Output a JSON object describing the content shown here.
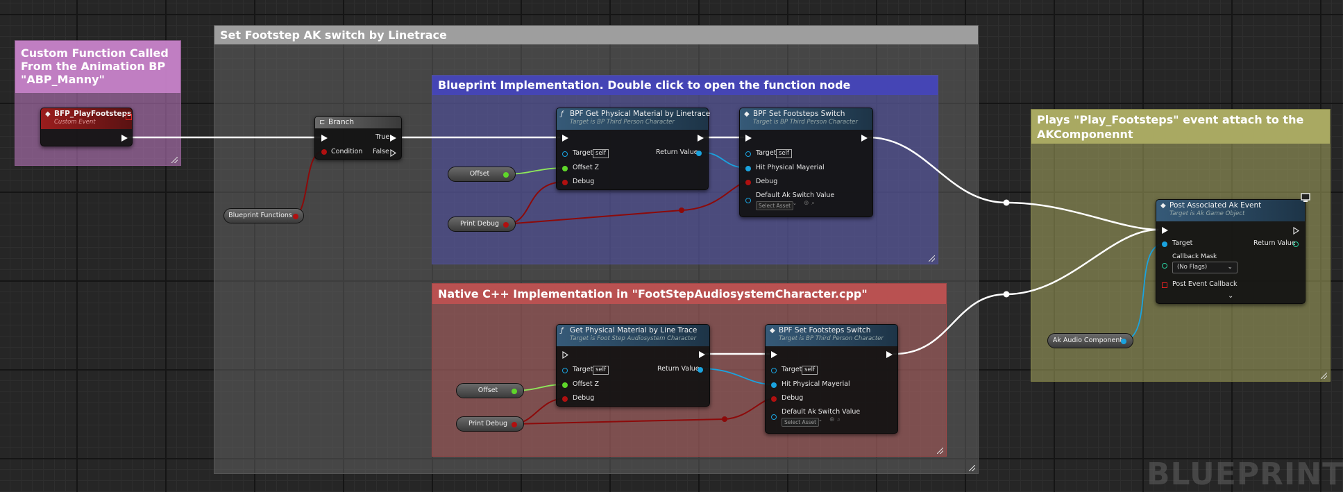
{
  "comments": {
    "custom_func": {
      "title": "Custom Function Called From the Animation BP \"ABP_Manny\""
    },
    "set_footstep": {
      "title": "Set Footstep AK switch by Linetrace"
    },
    "bp_impl": {
      "title": "Blueprint Implementation. Double click to open the function node"
    },
    "native_impl": {
      "title": "Native C++ Implementation in \"FootStepAudiosystemCharacter.cpp\""
    },
    "plays": {
      "title": "Plays \"Play_Footsteps\" event attach to the AKComponennt"
    }
  },
  "nodes": {
    "event": {
      "title": "BFP_PlayFootsteps",
      "subtitle": "Custom Event"
    },
    "branch": {
      "title": "Branch",
      "condition": "Condition",
      "true_label": "True",
      "false_label": "False"
    },
    "bp_get": {
      "title": "BPF Get Physical Material by Linetrace",
      "subtitle": "Target is BP Third Person Character",
      "target": "Target",
      "self": "self",
      "offset_z": "Offset Z",
      "debug": "Debug",
      "return": "Return Value"
    },
    "bp_set": {
      "title": "BPF Set Footsteps Switch",
      "subtitle": "Target is BP Third Person Character",
      "target": "Target",
      "self": "self",
      "hit": "Hit Physical Mayerial",
      "debug": "Debug",
      "default": "Default Ak Switch Value",
      "select": "Select Asset"
    },
    "native_get": {
      "title": "Get Physical Material by Line Trace",
      "subtitle": "Target is Foot Step Audiosystem Character",
      "target": "Target",
      "self": "self",
      "offset_z": "Offset Z",
      "debug": "Debug",
      "return": "Return Value"
    },
    "native_set": {
      "title": "BPF Set Footsteps Switch",
      "subtitle": "Target is BP Third Person Character",
      "target": "Target",
      "self": "self",
      "hit": "Hit Physical Mayerial",
      "debug": "Debug",
      "default": "Default Ak Switch Value",
      "select": "Select Asset"
    },
    "post": {
      "title": "Post Associated Ak Event",
      "subtitle": "Target is Ak Game Object",
      "target": "Target",
      "return": "Return Value",
      "callback_mask": "Callback Mask",
      "flags": "(No Flags)",
      "post_event_callback": "Post Event Callback"
    }
  },
  "variables": {
    "blueprint_functions": "Blueprint Functions",
    "bp_offset": "Offset",
    "bp_print_debug": "Print Debug",
    "native_offset": "Offset",
    "native_print_debug": "Print Debug",
    "ak_audio_component": "Ak Audio Component"
  },
  "watermark": "BLUEPRINT",
  "colors": {
    "exec_wire": "#ffffff",
    "bool_wire": "#8c0a0a",
    "float_wire": "#8ee85a",
    "object_wire": "#1aa3df",
    "event_header": "#8e1c1c",
    "function_header": "#2c4a63",
    "custom_comment": "#b877ba",
    "bp_comment": "#4747b3",
    "native_comment": "#b84e4e",
    "plays_comment": "#a8a860"
  },
  "icons": [
    "event-icon",
    "branch-icon",
    "function-icon",
    "monitor-icon",
    "chevron-down-icon",
    "magnifier-icon",
    "circle-plus-icon"
  ]
}
